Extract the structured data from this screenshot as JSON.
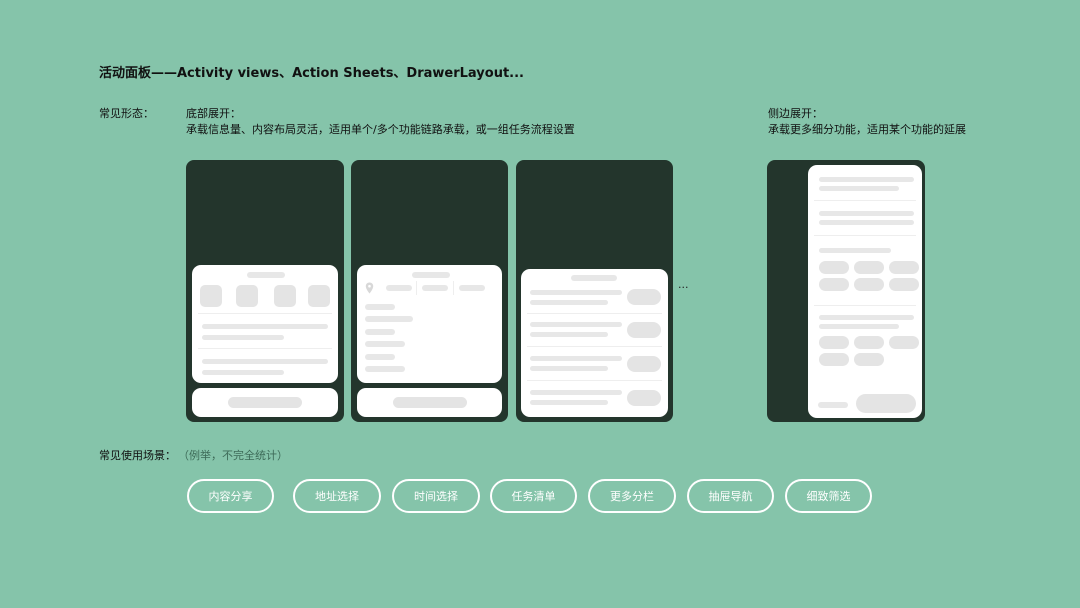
{
  "title": "活动面板——Activity views、Action Sheets、DrawerLayout...",
  "forms_label": "常见形态：",
  "bottom": {
    "heading": "底部展开：",
    "desc": "承载信息量、内容布局灵活，适用单个/多个功能链路承载，或一组任务流程设置"
  },
  "side": {
    "heading": "侧边展开：",
    "desc": "承载更多细分功能，适用某个功能的延展"
  },
  "ellipsis": "...",
  "scenes_label": "常见使用场景：",
  "scenes_note": "（例举，不完全统计）",
  "chips": [
    "内容分享",
    "地址选择",
    "时间选择",
    "任务清单",
    "更多分栏",
    "抽屉导航",
    "细致筛选"
  ],
  "icons": [
    "location-pin-icon"
  ],
  "colors": {
    "background": "#85c4aa",
    "phone": "#23352c",
    "card": "#ffffff",
    "placeholder": "#e4e4e4"
  }
}
